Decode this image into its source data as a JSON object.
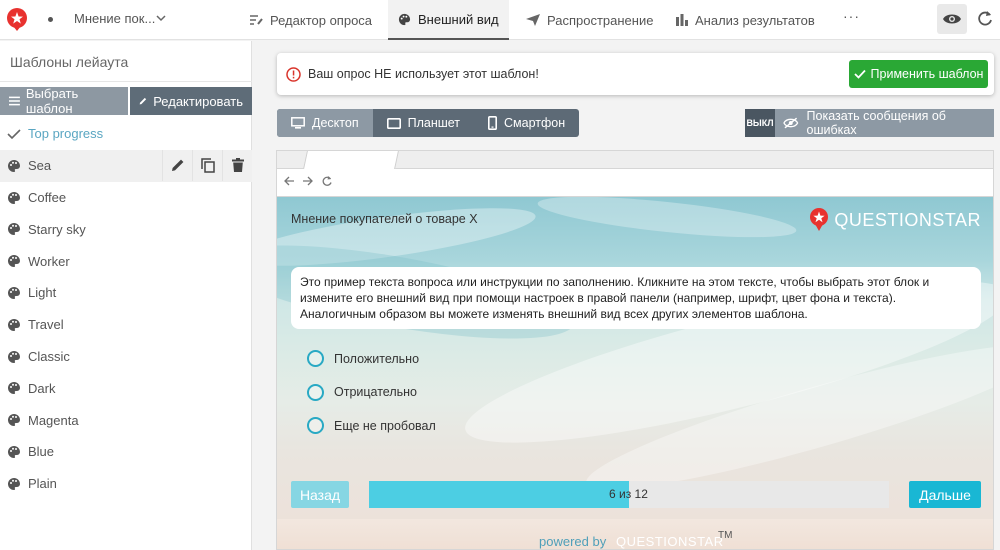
{
  "topbar": {
    "survey_name": "Мнение пок...",
    "tabs": [
      {
        "label": "Редактор опроса",
        "icon": "edit-list-icon"
      },
      {
        "label": "Внешний вид",
        "icon": "palette-icon",
        "active": true
      },
      {
        "label": "Распространение",
        "icon": "send-icon"
      },
      {
        "label": "Анализ результатов",
        "icon": "bar-chart-icon"
      }
    ],
    "more": "···"
  },
  "sidebar": {
    "title": "Шаблоны лейаута",
    "select_btn": "Выбрать шаблон",
    "edit_btn": "Редактировать",
    "templates": [
      {
        "label": "Top progress",
        "icon": "check-icon"
      },
      {
        "label": "Sea",
        "icon": "palette-icon",
        "selected": true
      },
      {
        "label": "Coffee",
        "icon": "palette-icon"
      },
      {
        "label": "Starry sky",
        "icon": "palette-icon"
      },
      {
        "label": "Worker",
        "icon": "palette-icon"
      },
      {
        "label": "Light",
        "icon": "palette-icon"
      },
      {
        "label": "Travel",
        "icon": "palette-icon"
      },
      {
        "label": "Classic",
        "icon": "palette-icon"
      },
      {
        "label": "Dark",
        "icon": "palette-icon"
      },
      {
        "label": "Magenta",
        "icon": "palette-icon"
      },
      {
        "label": "Blue",
        "icon": "palette-icon"
      },
      {
        "label": "Plain",
        "icon": "palette-icon"
      }
    ]
  },
  "notice": {
    "text": "Ваш опрос НЕ использует этот шаблон!",
    "apply_btn": "Применить шаблон"
  },
  "devices": {
    "desktop": "Десктоп",
    "tablet": "Планшет",
    "phone": "Смартфон",
    "active": "desktop"
  },
  "errors_toggle": {
    "state": "ВЫКЛ",
    "label": "Показать сообщения об ошибках"
  },
  "survey": {
    "title": "Мнение покупателей о товаре X",
    "brand": "QUESTIONSTAR",
    "question": "Это пример текста вопроса или инструкции по заполнению. Кликните на этом тексте, чтобы выбрать этот блок и измените его внешний вид при помощи настроек в правой панели (например, шрифт, цвет фона и текста). Аналогичным образом вы можете изменять внешний вид всех других элементов шаблона.",
    "answers": [
      "Положительно",
      "Отрицательно",
      "Еще не пробовал"
    ],
    "back": "Назад",
    "next": "Дальше",
    "progress_text": "6 из 12",
    "progress_fraction": 0.5,
    "powered_by": "powered by",
    "powered_brand": "QUESTIONSTAR",
    "tm": "TM"
  },
  "colors": {
    "apply_green": "#2aa835",
    "accent_cyan": "#19b7d4",
    "progress_cyan": "#4ccee3",
    "toolbar_slate": "#5d6a76",
    "logo_red": "#e8322f"
  }
}
